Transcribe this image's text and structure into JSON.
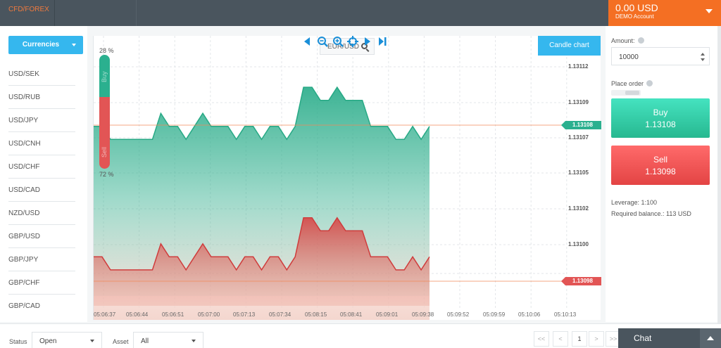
{
  "topbar": {
    "tab_label": "CFD/FOREX",
    "balance": "0.00 USD",
    "account_type": "DEMO Account"
  },
  "left_panel": {
    "filter_label": "Currencies",
    "pairs": [
      "USD/SEK",
      "USD/RUB",
      "USD/JPY",
      "USD/CNH",
      "USD/CHF",
      "USD/CAD",
      "NZD/USD",
      "GBP/USD",
      "GBP/JPY",
      "GBP/CHF",
      "GBP/CAD"
    ]
  },
  "chart_header": {
    "symbol": "EUR/USD",
    "candle_label": "Candle chart"
  },
  "sentiment": {
    "buy_label": "Buy",
    "sell_label": "Sell",
    "buy_pct": "28 %",
    "sell_pct": "72 %"
  },
  "chart_data": {
    "type": "area",
    "y_ticks": [
      "1.13112",
      "1.13109",
      "1.13107",
      "1.13105",
      "1.13102",
      "1.13100"
    ],
    "buy_tag": "1.13108",
    "sell_tag": "1.13098",
    "x_ticks": [
      "05:06:37",
      "05:06:44",
      "05:06:51",
      "05:07:00",
      "05:07:13",
      "05:07:34",
      "05:08:15",
      "05:08:41",
      "05:09:01",
      "05:09:38",
      "05:09:52",
      "05:09:59",
      "05:10:06",
      "05:10:13"
    ],
    "ask_series_approx": [
      1.13108,
      1.13108,
      1.13107,
      1.13107,
      1.13107,
      1.13107,
      1.13107,
      1.13107,
      1.13109,
      1.13108,
      1.13108,
      1.13107,
      1.13108,
      1.13109,
      1.13108,
      1.13108,
      1.13108,
      1.13107,
      1.13108,
      1.13108,
      1.13107,
      1.13108,
      1.13108,
      1.13107,
      1.13108,
      1.13111,
      1.13111,
      1.1311,
      1.1311,
      1.13111,
      1.1311,
      1.1311,
      1.1311,
      1.13108,
      1.13108,
      1.13108,
      1.13107,
      1.13107,
      1.13108,
      1.13107,
      1.13108
    ],
    "bid_series_approx": [
      1.13098,
      1.13098,
      1.13097,
      1.13097,
      1.13097,
      1.13097,
      1.13097,
      1.13097,
      1.13099,
      1.13098,
      1.13098,
      1.13097,
      1.13098,
      1.13099,
      1.13098,
      1.13098,
      1.13098,
      1.13097,
      1.13098,
      1.13098,
      1.13097,
      1.13098,
      1.13098,
      1.13097,
      1.13098,
      1.13101,
      1.13101,
      1.131,
      1.131,
      1.13101,
      1.131,
      1.131,
      1.131,
      1.13098,
      1.13098,
      1.13098,
      1.13097,
      1.13097,
      1.13098,
      1.13097,
      1.13098
    ]
  },
  "order_panel": {
    "amount_label": "Amount:",
    "amount_value": "10000",
    "place_order_label": "Place order",
    "buy_label": "Buy",
    "buy_price": "1.13108",
    "sell_label": "Sell",
    "sell_price": "1.13098",
    "leverage": "Leverage: 1:100",
    "required_balance": "Required balance.: 113 USD"
  },
  "bottom_bar": {
    "status_label": "Status",
    "status_value": "Open",
    "asset_label": "Asset",
    "asset_value": "All",
    "pagination": [
      "<<",
      "<",
      "1",
      ">",
      ">>"
    ],
    "chat_label": "Chat"
  },
  "colors": {
    "accent_blue": "#35b7ee",
    "buy_green": "#2bb08f",
    "sell_red": "#e25555",
    "topbar": "#4a555e",
    "account_orange": "#f46f23"
  }
}
